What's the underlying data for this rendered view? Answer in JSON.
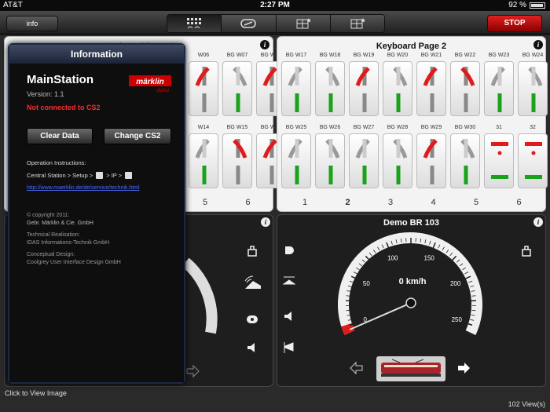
{
  "status_bar": {
    "carrier": "AT&T",
    "time": "2:27 PM",
    "battery": "92 %"
  },
  "toolbar": {
    "info_label": "info",
    "stop_label": "STOP",
    "segments": [
      "keyboard-icon",
      "locomotive-icon",
      "layout-icon",
      "layout-star-icon"
    ]
  },
  "keyboard_right": {
    "title": "Keyboard Page 2",
    "row1": [
      "BG W17",
      "BG W18",
      "BG W19",
      "BG W20",
      "BG W21",
      "BG W22",
      "BG W23",
      "BG W24"
    ],
    "row2": [
      "BG W25",
      "BG W26",
      "BG W27",
      "BG W28",
      "BG W29",
      "BG W30",
      "31",
      "32"
    ],
    "footer": [
      "1",
      "2",
      "3",
      "4",
      "5",
      "6"
    ]
  },
  "keyboard_left": {
    "title": "Keyboard Page 1",
    "row1": [
      "W06",
      "BG W07",
      "BG W08"
    ],
    "row2": [
      "W14",
      "BG W15",
      "BG W16"
    ],
    "footer": [
      "5",
      "6"
    ]
  },
  "loco_right": {
    "title": "Demo BR 103",
    "speed": "0 km/h",
    "ticks": [
      "0",
      "50",
      "100",
      "150",
      "200",
      "250"
    ]
  },
  "popover": {
    "header": "Information",
    "app_name": "MainStation",
    "logo_text": "märklin",
    "logo_sub": "digital",
    "version": "Version: 1.1",
    "connection": "Not connected to CS2",
    "clear_data": "Clear Data",
    "change_cs2": "Change CS2",
    "op_title": "Operation Instructions:",
    "op_path_1": "Central Station > Setup >",
    "op_path_2": "> IP >",
    "link": "http://www.maerklin.de/de/service/technik.html",
    "copyright_1": "© copyright 2011:",
    "copyright_2": "Gebr. Märklin & Cie. GmbH",
    "tech_1": "Technical Realisation:",
    "tech_2": "IDAS Informations-Technik GmbH",
    "concept_1": "Conceptual Design:",
    "concept_2": "Coolgrey User Interface Design GmbH"
  },
  "footer": {
    "click_to_view": "Click to View Image",
    "views": "102 View(s)"
  },
  "colors": {
    "accent_red": "#e01b1b",
    "accent_green": "#1ba21b",
    "stop_red": "#c40000",
    "link_blue": "#4a6bff"
  }
}
